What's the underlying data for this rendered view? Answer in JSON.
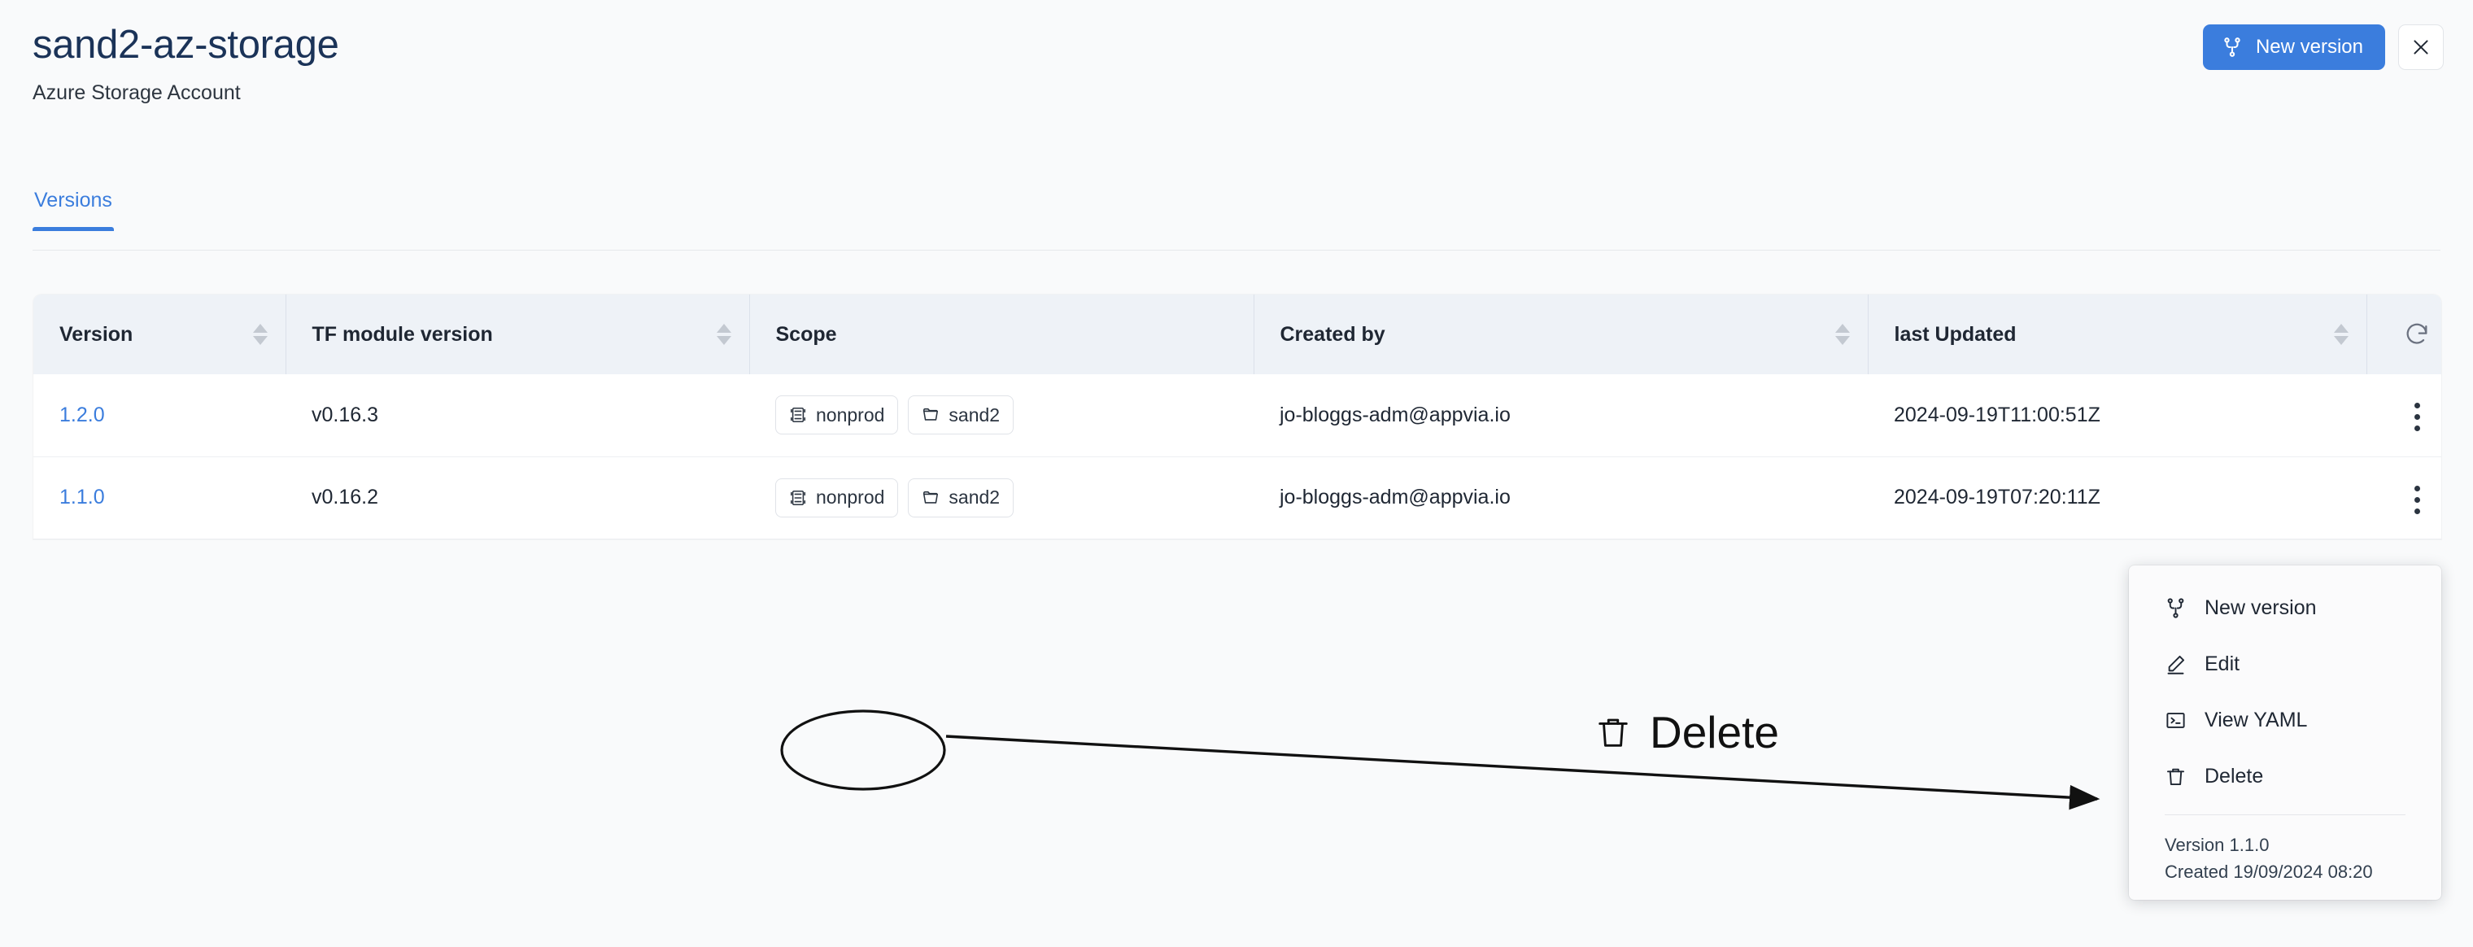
{
  "header": {
    "title": "sand2-az-storage",
    "subtitle": "Azure Storage Account",
    "new_version_label": "New version",
    "close_label": "×"
  },
  "tabs": [
    {
      "label": "Versions",
      "active": true
    }
  ],
  "table": {
    "columns": [
      {
        "key": "version",
        "label": "Version",
        "sortable": true
      },
      {
        "key": "tf_module_version",
        "label": "TF module version",
        "sortable": true
      },
      {
        "key": "scope",
        "label": "Scope",
        "sortable": false
      },
      {
        "key": "created_by",
        "label": "Created by",
        "sortable": true
      },
      {
        "key": "last_updated",
        "label": "last Updated",
        "sortable": true
      }
    ],
    "refresh_icon": "refresh-icon",
    "rows": [
      {
        "version": "1.2.0",
        "tf_module_version": "v0.16.3",
        "scope": [
          {
            "label": "nonprod",
            "icon": "server-icon"
          },
          {
            "label": "sand2",
            "icon": "folder-icon"
          }
        ],
        "created_by": "jo-bloggs-adm@appvia.io",
        "last_updated": "2024-09-19T11:00:51Z"
      },
      {
        "version": "1.1.0",
        "tf_module_version": "v0.16.2",
        "scope": [
          {
            "label": "nonprod",
            "icon": "server-icon"
          },
          {
            "label": "sand2",
            "icon": "folder-icon"
          }
        ],
        "created_by": "jo-bloggs-adm@appvia.io",
        "last_updated": "2024-09-19T07:20:11Z"
      }
    ]
  },
  "context_menu": {
    "items": [
      {
        "label": "New version",
        "icon": "git-branch-icon"
      },
      {
        "label": "Edit",
        "icon": "pencil-icon"
      },
      {
        "label": "View YAML",
        "icon": "terminal-icon"
      },
      {
        "label": "Delete",
        "icon": "trash-icon"
      }
    ],
    "footer": {
      "version_line": "Version 1.1.0",
      "created_line": "Created 19/09/2024 08:20"
    }
  },
  "annotation": {
    "label": "Delete",
    "icon": "trash-icon"
  },
  "colors": {
    "accent": "#3b7ddd",
    "title": "#1b3358",
    "page_bg": "#f9fafb",
    "table_header_bg": "#eef2f7",
    "row_bg": "#ffffff"
  }
}
